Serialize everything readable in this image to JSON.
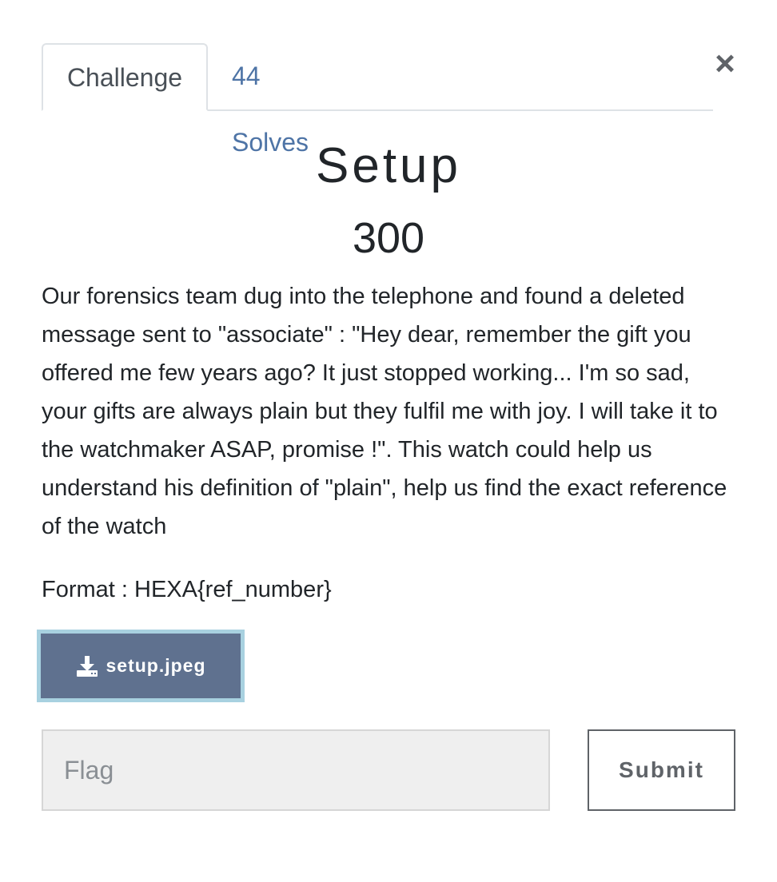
{
  "tabs": {
    "challenge_label": "Challenge",
    "solves_label": "44 Solves"
  },
  "close": {
    "symbol": "×"
  },
  "challenge": {
    "name": "Setup",
    "points": "300",
    "description": "Our forensics team dug into the telephone and found a deleted message sent to \"associate\" : \"Hey dear, remember the gift you offered me few years ago? It just stopped working... I'm so sad, your gifts are always plain but they fulfil me with joy. I will take it to the watchmaker ASAP, promise !\". This watch could help us understand his definition of \"plain\", help us find the exact reference of the watch",
    "format": "Format : HEXA{ref_number}"
  },
  "file": {
    "name": "setup.jpeg",
    "icon": "download-icon"
  },
  "flag": {
    "placeholder": "Flag",
    "value": ""
  },
  "submit": {
    "label": "Submit"
  },
  "colors": {
    "tab_link": "#4e74a6",
    "file_button_bg": "#5f718f",
    "file_button_border": "#a8d1e0",
    "input_bg": "#efefef"
  }
}
